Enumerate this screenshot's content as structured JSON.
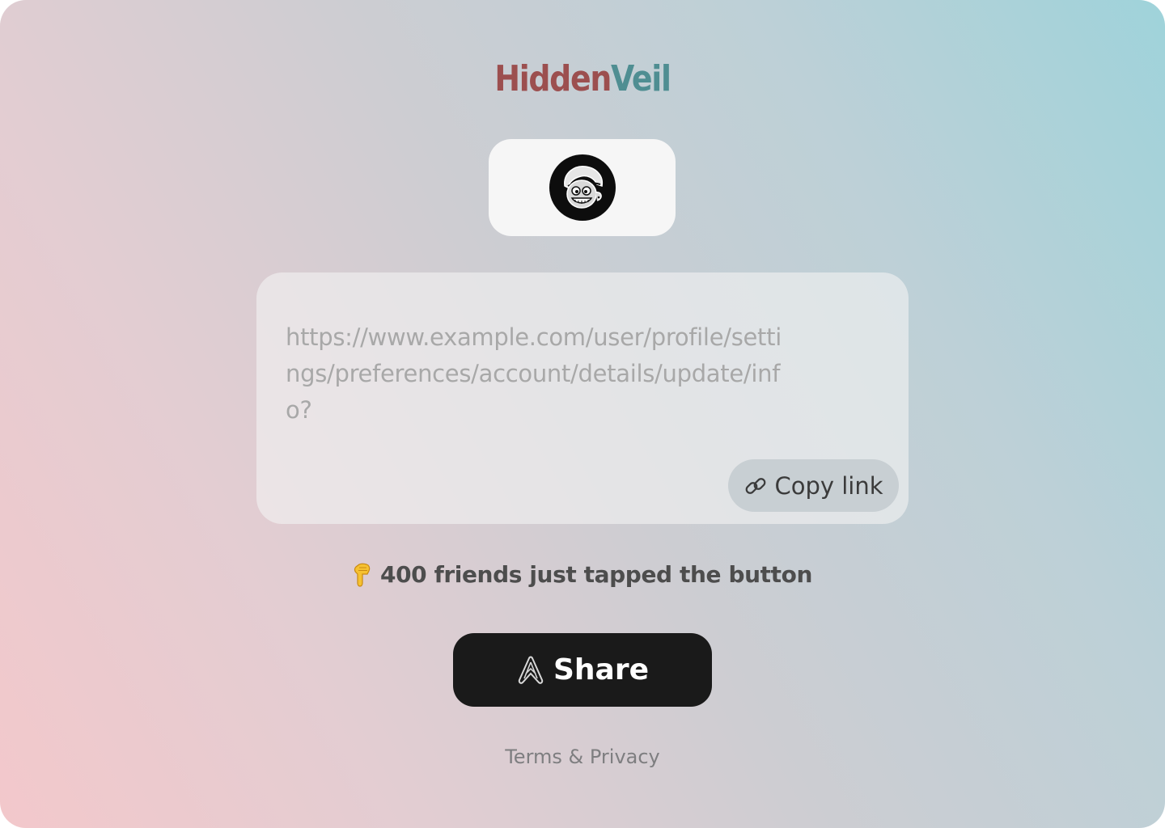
{
  "brand": {
    "part1": "Hidden",
    "part2": "Veil",
    "colors": {
      "part1": "#9c4f4f",
      "part2": "#4f8e92"
    }
  },
  "avatar": {
    "icon": "cartoon-character-avatar"
  },
  "link_box": {
    "url": "https://www.example.com/user/profile/settings/preferences/account/details/update/info?",
    "copy_icon": "link-chain-icon",
    "copy_label": "Copy link"
  },
  "social_proof": {
    "icon": "pointing-down-hand-emoji",
    "text": "400 friends just tapped the button"
  },
  "share_button": {
    "icon": "share-icon",
    "label": "Share",
    "color": "#1a1a1a"
  },
  "footer": {
    "link": "Terms & Privacy"
  }
}
